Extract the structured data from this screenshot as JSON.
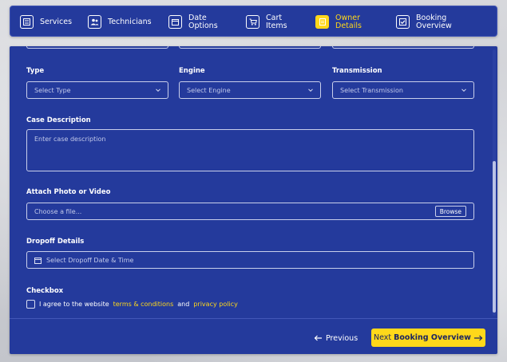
{
  "steps": [
    {
      "label": "Services",
      "icon": "list-card-icon",
      "active": false
    },
    {
      "label": "Technicians",
      "icon": "users-icon",
      "active": false
    },
    {
      "label": "Date\nOptions",
      "icon": "calendar-icon",
      "active": false
    },
    {
      "label": "Cart\nItems",
      "icon": "cart-icon",
      "active": false
    },
    {
      "label": "Owner\nDetails",
      "icon": "document-icon",
      "active": true
    },
    {
      "label": "Booking\nOverview",
      "icon": "checkbox-icon",
      "active": false
    }
  ],
  "form": {
    "type": {
      "label": "Type",
      "placeholder": "Select Type"
    },
    "engine": {
      "label": "Engine",
      "placeholder": "Select Engine"
    },
    "transmission": {
      "label": "Transmission",
      "placeholder": "Select Transmission"
    },
    "case_description": {
      "label": "Case Description",
      "placeholder": "Enter case description"
    },
    "attachment": {
      "label": "Attach Photo or Video",
      "placeholder": "Choose a file...",
      "browse_label": "Browse"
    },
    "dropoff": {
      "label": "Dropoff Details",
      "placeholder": "Select Dropoff Date & Time"
    },
    "checkbox": {
      "label": "Checkbox",
      "text_prefix": "I agree to the website",
      "terms_link": "terms & conditions",
      "and_text": "and",
      "privacy_link": "privacy policy"
    }
  },
  "footer": {
    "previous_label": "Previous",
    "next_prefix": "Next",
    "next_target": "Booking Overview"
  },
  "colors": {
    "panel": "#243a9c",
    "accent": "#ffd81a",
    "text": "#ffffff"
  }
}
